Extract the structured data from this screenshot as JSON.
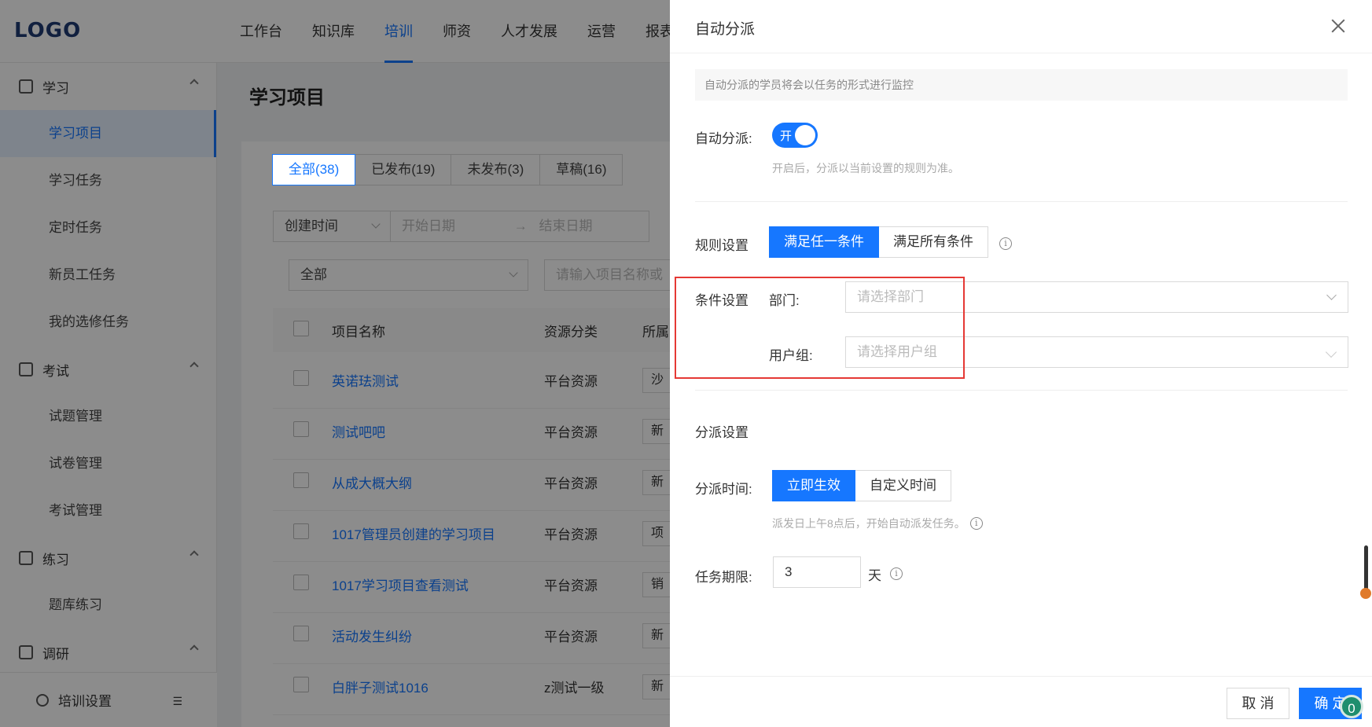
{
  "app": {
    "logo": "LOGO",
    "top_nav": [
      "工作台",
      "知识库",
      "培训",
      "师资",
      "人才发展",
      "运营",
      "报表"
    ],
    "sidebar": {
      "groups": [
        {
          "label": "学习",
          "icon": "book-icon",
          "items": [
            "学习项目",
            "学习任务",
            "定时任务",
            "新员工任务",
            "我的选修任务"
          ]
        },
        {
          "label": "考试",
          "icon": "exam-icon",
          "items": [
            "试题管理",
            "试卷管理",
            "考试管理"
          ]
        },
        {
          "label": "练习",
          "icon": "pen-icon",
          "items": [
            "题库练习"
          ]
        },
        {
          "label": "调研",
          "icon": "survey-icon",
          "items": []
        }
      ],
      "active_item": "学习项目",
      "bottom_label": "培训设置"
    },
    "page_title": "学习项目",
    "tabs": [
      "全部(38)",
      "已发布(19)",
      "未发布(3)",
      "草稿(16)"
    ],
    "filters": {
      "time_type": "创建时间",
      "start_placeholder": "开始日期",
      "arrow": "→",
      "end_placeholder": "结束日期",
      "scope": "全部",
      "search_placeholder": "请输入项目名称或"
    },
    "table": {
      "headers": [
        "项目名称",
        "资源分类",
        "所属"
      ],
      "rows": [
        {
          "name": "英诺珐测试",
          "res": "平台资源",
          "extra": "沙"
        },
        {
          "name": "测试吧吧",
          "res": "平台资源",
          "extra": "新"
        },
        {
          "name": "从成大概大纲",
          "res": "平台资源",
          "extra": "新"
        },
        {
          "name": "1017管理员创建的学习项目",
          "res": "平台资源",
          "extra": "项"
        },
        {
          "name": "1017学习项目查看测试",
          "res": "平台资源",
          "extra": "销"
        },
        {
          "name": "活动发生纠纷",
          "res": "平台资源",
          "extra": "新"
        },
        {
          "name": "白胖子测试1016",
          "res": "z测试一级",
          "extra": "新"
        }
      ]
    }
  },
  "drawer": {
    "title": "自动分派",
    "info": "自动分派的学员将会以任务的形式进行监控",
    "auto_label": "自动分派:",
    "switch_text": "开",
    "switch_on": true,
    "auto_hint": "开启后，分派以当前设置的规则为准。",
    "rule_label": "规则设置",
    "rule_options": [
      "满足任一条件",
      "满足所有条件"
    ],
    "rule_active": 0,
    "condition_label": "条件设置",
    "dept_label": "部门:",
    "dept_placeholder": "请选择部门",
    "group_label": "用户组:",
    "group_placeholder": "请选择用户组",
    "dispatch_label": "分派设置",
    "dispatch_time_label": "分派时间:",
    "dispatch_options": [
      "立即生效",
      "自定义时间"
    ],
    "dispatch_active": 0,
    "dispatch_hint": "派发日上午8点后，开始自动派发任务。",
    "deadline_label": "任务期限:",
    "deadline_value": "3",
    "deadline_unit": "天",
    "cancel": "取 消",
    "ok": "确 定",
    "badge": "0",
    "highlight_color": "#e53935"
  },
  "colors": {
    "primary": "#1677ff",
    "mask": "rgba(0,0,0,0.45)"
  }
}
